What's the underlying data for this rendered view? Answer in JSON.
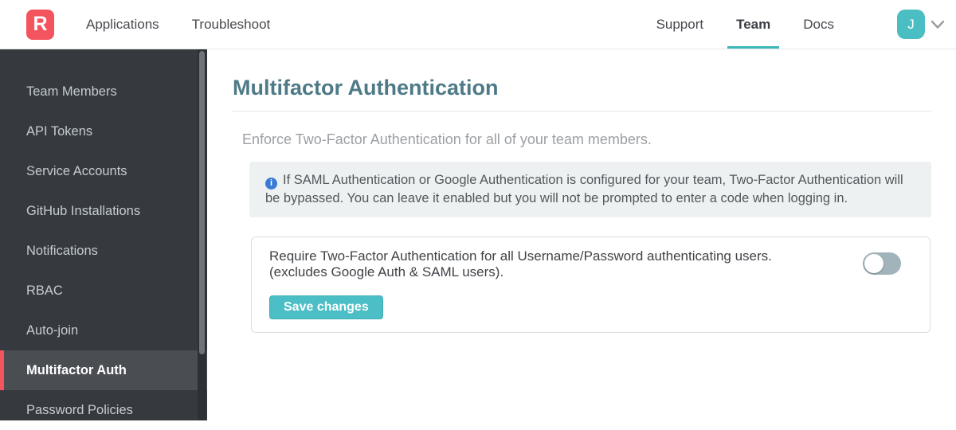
{
  "navbar": {
    "logo_letter": "R",
    "left_items": [
      {
        "label": "Applications"
      },
      {
        "label": "Troubleshoot"
      }
    ],
    "right_items": [
      {
        "label": "Support",
        "active": false
      },
      {
        "label": "Team",
        "active": true
      },
      {
        "label": "Docs",
        "active": false
      }
    ],
    "avatar_initial": "J",
    "icons": {
      "chevron_down": "chevron-down"
    }
  },
  "sidebar": {
    "items": [
      {
        "label": "Team Members",
        "active": false
      },
      {
        "label": "API Tokens",
        "active": false
      },
      {
        "label": "Service Accounts",
        "active": false
      },
      {
        "label": "GitHub Installations",
        "active": false
      },
      {
        "label": "Notifications",
        "active": false
      },
      {
        "label": "RBAC",
        "active": false
      },
      {
        "label": "Auto-join",
        "active": false
      },
      {
        "label": "Multifactor Auth",
        "active": true
      },
      {
        "label": "Password Policies",
        "active": false
      }
    ]
  },
  "main": {
    "title": "Multifactor Authentication",
    "description": "Enforce Two-Factor Authentication for all of your team members.",
    "info_note": {
      "icon_letter": "i",
      "text": "If SAML Authentication or Google Authentication is configured for your team, Two-Factor Authentication will be bypassed. You can leave it enabled but you will not be prompted to enter a code when logging in."
    },
    "setting": {
      "label_line1": "Require Two-Factor Authentication for all Username/Password authenticating users.",
      "label_line2": "(excludes Google Auth & SAML users).",
      "toggle_state": "off"
    },
    "save_button_label": "Save changes"
  },
  "colors": {
    "brand_red": "#F4545E",
    "accent_teal": "#4BBEC4",
    "tab_underline_teal": "#3EB7B8",
    "heading_teal": "#4E7A87",
    "sidebar_bg": "#36393D",
    "sidebar_active_bg": "#4A4E53",
    "info_box_bg": "#EEF1F2",
    "info_icon_blue": "#3A7BD5",
    "toggle_off_bg": "#A2B4BB",
    "save_button_bg": "#4CBEC5"
  }
}
